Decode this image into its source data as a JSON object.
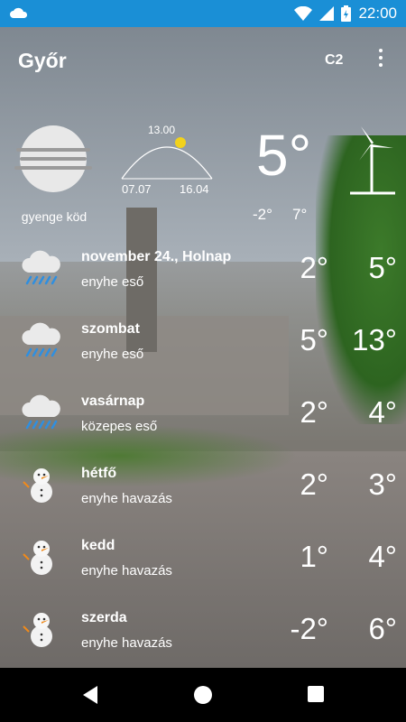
{
  "status": {
    "time": "22:00"
  },
  "header": {
    "city": "Győr",
    "unit": "C2"
  },
  "current": {
    "description": "gyenge köd",
    "temp": "5°",
    "min": "-2°",
    "max": "7°",
    "sun": {
      "noon": "13.00",
      "sunrise": "07.07",
      "sunset": "16.04"
    }
  },
  "forecast": [
    {
      "day": "november 24., Holnap",
      "cond": "enyhe eső",
      "lo": "2°",
      "hi": "5°",
      "icon": "rain-cloud-icon"
    },
    {
      "day": "szombat",
      "cond": "enyhe eső",
      "lo": "5°",
      "hi": "13°",
      "icon": "rain-cloud-icon"
    },
    {
      "day": "vasárnap",
      "cond": "közepes eső",
      "lo": "2°",
      "hi": "4°",
      "icon": "rain-cloud-icon"
    },
    {
      "day": "hétfő",
      "cond": "enyhe havazás",
      "lo": "2°",
      "hi": "3°",
      "icon": "snowman-icon"
    },
    {
      "day": "kedd",
      "cond": "enyhe havazás",
      "lo": "1°",
      "hi": "4°",
      "icon": "snowman-icon"
    },
    {
      "day": "szerda",
      "cond": "enyhe havazás",
      "lo": "-2°",
      "hi": "6°",
      "icon": "snowman-icon"
    }
  ],
  "colors": {
    "statusbar": "#1a8fd6",
    "navbar": "#000000",
    "text": "#ffffff"
  }
}
